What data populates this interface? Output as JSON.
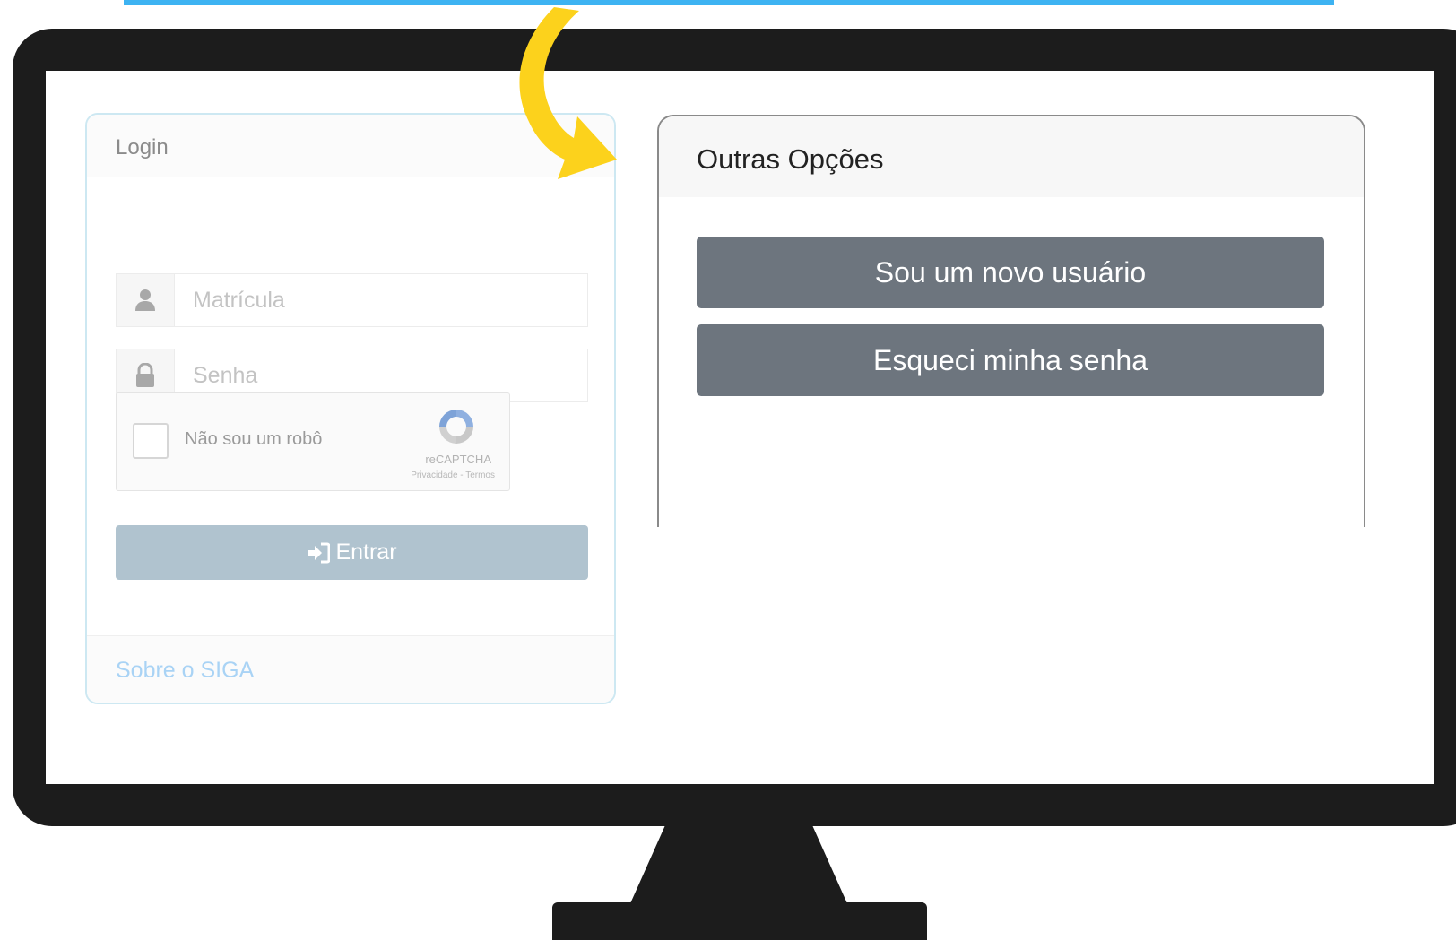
{
  "login": {
    "title": "Login",
    "username_placeholder": "Matrícula",
    "password_placeholder": "Senha",
    "captcha": {
      "label": "Não sou um robô",
      "brand": "reCAPTCHA",
      "terms": "Privacidade - Termos"
    },
    "enter_label": "Entrar",
    "footer_link": "Sobre o SIGA"
  },
  "options": {
    "title": "Outras Opções",
    "new_user_label": "Sou um novo usuário",
    "forgot_password_label": "Esqueci minha senha"
  },
  "colors": {
    "highlight_bar": "#3db3f2",
    "arrow": "#fcd21c",
    "option_button": "#6d757e",
    "enter_button": "#b0c3cf"
  },
  "icons": {
    "username": "user-icon",
    "password": "lock-icon",
    "enter": "sign-in-icon",
    "captcha": "recaptcha-icon",
    "arrow": "curved-arrow-icon"
  }
}
